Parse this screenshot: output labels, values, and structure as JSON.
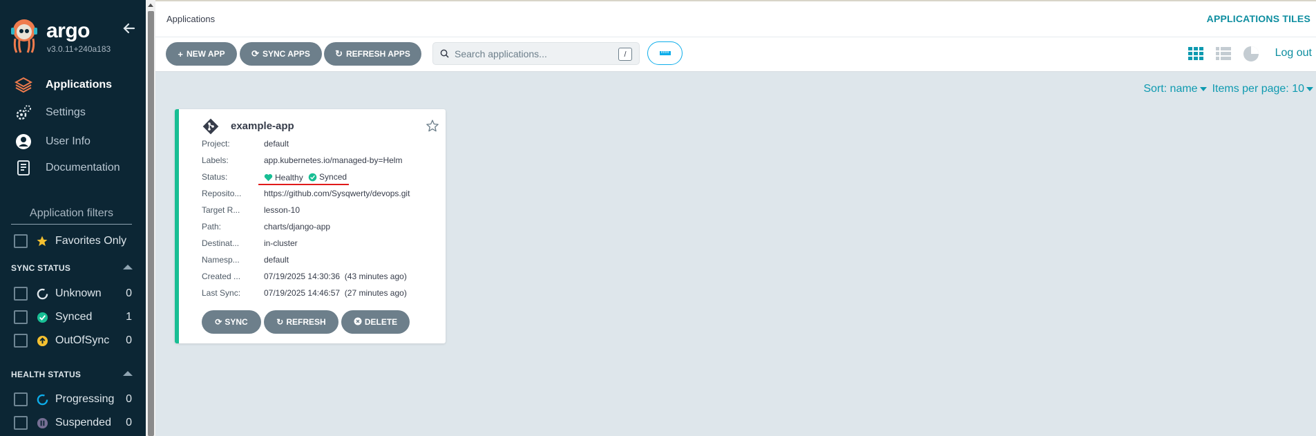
{
  "sidebar": {
    "brand": "argo",
    "version": "v3.0.11+240a183",
    "nav": [
      {
        "label": "Applications",
        "icon": "layers-icon",
        "active": true
      },
      {
        "label": "Settings",
        "icon": "gear-icon"
      },
      {
        "label": "User Info",
        "icon": "user-icon"
      },
      {
        "label": "Documentation",
        "icon": "book-icon"
      }
    ],
    "filters_title": "Application filters",
    "favorites_label": "Favorites Only",
    "sync_status": {
      "title": "SYNC STATUS",
      "items": [
        {
          "label": "Unknown",
          "count": "0",
          "color": "#dee6eb"
        },
        {
          "label": "Synced",
          "count": "1",
          "color": "#18be94"
        },
        {
          "label": "OutOfSync",
          "count": "0",
          "color": "#f4c030"
        }
      ]
    },
    "health_status": {
      "title": "HEALTH STATUS",
      "items": [
        {
          "label": "Progressing",
          "count": "0",
          "color": "#0dadea"
        },
        {
          "label": "Suspended",
          "count": "0",
          "color": "#766f94"
        }
      ]
    }
  },
  "header": {
    "breadcrumb": "Applications",
    "view_title": "APPLICATIONS TILES"
  },
  "toolbar": {
    "new_app": "NEW APP",
    "sync_apps": "SYNC APPS",
    "refresh_apps": "REFRESH APPS",
    "search_placeholder": "Search applications...",
    "search_shortcut": "/",
    "logout": "Log out"
  },
  "sort": {
    "sort_label": "Sort: name",
    "items_per_page": "Items per page: 10"
  },
  "app": {
    "name": "example-app",
    "fields": [
      {
        "key": "Project:",
        "value": "default"
      },
      {
        "key": "Labels:",
        "value": "app.kubernetes.io/managed-by=Helm"
      },
      {
        "key": "Status:",
        "value": ""
      },
      {
        "key": "Reposito...",
        "value": "https://github.com/Sysqwerty/devops.git"
      },
      {
        "key": "Target R...",
        "value": "lesson-10"
      },
      {
        "key": "Path:",
        "value": "charts/django-app"
      },
      {
        "key": "Destinat...",
        "value": "in-cluster"
      },
      {
        "key": "Namesp...",
        "value": "default"
      },
      {
        "key": "Created ...",
        "value": "07/19/2025 14:30:36  (43 minutes ago)"
      },
      {
        "key": "Last Sync:",
        "value": "07/19/2025 14:46:57  (27 minutes ago)"
      }
    ],
    "health": "Healthy",
    "sync": "Synced",
    "actions": {
      "sync": "SYNC",
      "refresh": "REFRESH",
      "delete": "DELETE"
    }
  },
  "colors": {
    "accent": "#0e8ea0",
    "healthy": "#18be94",
    "button": "#6d7f8b",
    "sidebar": "#0c2634"
  }
}
